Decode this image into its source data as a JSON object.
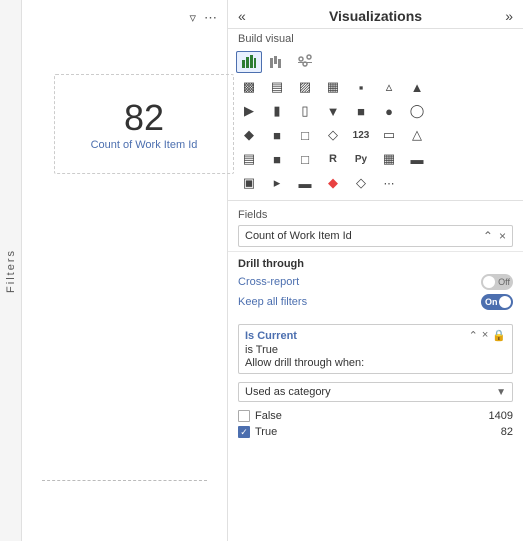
{
  "left": {
    "filters_label": "Filters",
    "card_number": "82",
    "card_label": "Count of Work Item Id"
  },
  "right": {
    "title": "Visualizations",
    "build_visual": "Build visual",
    "fields_label": "Fields",
    "field_chip": "Count of Work Item Id",
    "drill_through_label": "Drill through",
    "cross_report_label": "Cross-report",
    "cross_report_toggle": "Off",
    "keep_filters_label": "Keep all filters",
    "keep_filters_toggle": "On",
    "filter_title": "Is Current",
    "filter_condition": "is True",
    "filter_allow_text": "Allow drill through when:",
    "dropdown_value": "Used as category",
    "checkboxes": [
      {
        "label": "False",
        "count": "1409",
        "checked": false
      },
      {
        "label": "True",
        "count": "82",
        "checked": true
      }
    ]
  }
}
